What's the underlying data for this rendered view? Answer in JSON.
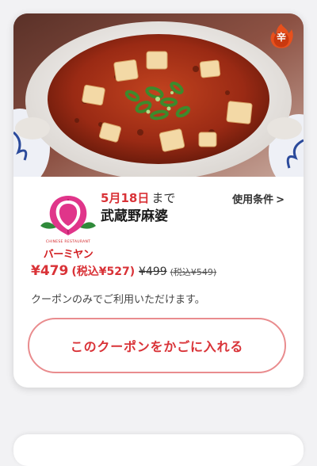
{
  "coupon": {
    "hero_image": "mapo-tofu-claypot-photo",
    "spicy_badge": {
      "icon": "flame-icon",
      "label": "辛",
      "color": "#e8501c"
    },
    "brand": {
      "logo": "bamiyan-peach-logo",
      "subtitle": "CHINESE RESTAURANT",
      "name": "バーミヤン",
      "color": "#d21f22"
    },
    "date": {
      "month": "5",
      "month_unit": "月",
      "day": "18",
      "day_unit": "日",
      "suffix": "まで"
    },
    "product_name": "武蔵野麻婆",
    "terms_label": "使用条件",
    "terms_chevron": ">",
    "price": {
      "current": "¥479",
      "current_tax": "(税込¥527)",
      "original": "¥499",
      "original_tax": "(税込¥549)"
    },
    "note": "クーポンのみでご利用いただけます。",
    "cta_label": "このクーポンをかごに入れる",
    "accent_color": "#d93237"
  }
}
